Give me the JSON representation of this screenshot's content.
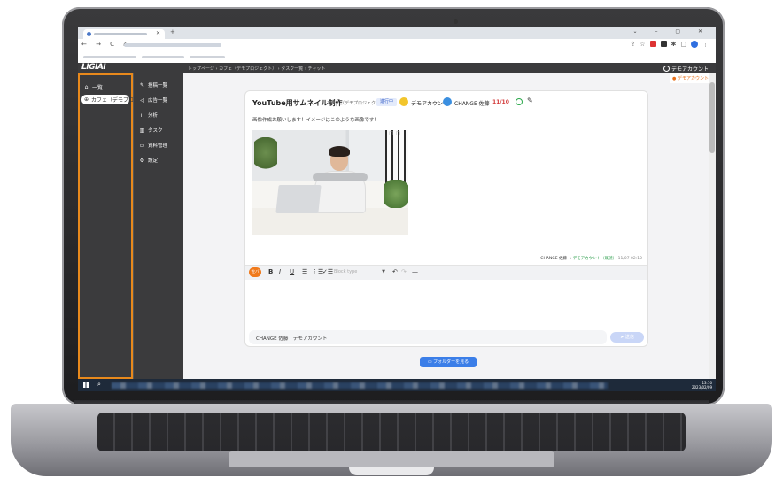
{
  "browser": {
    "window_controls": "⌄ – ▢ ✕",
    "new_tab": "+",
    "tab_close": "✕",
    "nav": "← → C ⌂"
  },
  "app": {
    "logo": "LIGIAI",
    "breadcrumb": "トップページ › カフェ（デモプロジェクト） › タスク一覧 › チャット",
    "account_name": "デモアカウント",
    "account_popup": "● デモアカウント",
    "accent": "#e8891c"
  },
  "sidebar": {
    "items": [
      {
        "icon": "⌂",
        "label": "一覧"
      },
      {
        "icon": "⊕",
        "label": "カフェ（デモプロ..."
      }
    ]
  },
  "subnav": {
    "items": [
      {
        "icon": "✎",
        "label": "投稿一覧"
      },
      {
        "icon": "◁",
        "label": "広告一覧"
      },
      {
        "icon": "ıl",
        "label": "分析"
      },
      {
        "icon": "▥",
        "label": "タスク"
      },
      {
        "icon": "▭",
        "label": "資料管理"
      },
      {
        "icon": "⚙",
        "label": "設定"
      }
    ]
  },
  "task": {
    "title": "YouTube用サムネイル制作",
    "project": "カフェ（デモプロジェクト）",
    "status": "進行中",
    "assignee": "デモアカウント",
    "requester": "CHANGE 佐藤",
    "count": "11/10"
  },
  "message": {
    "text": "画像作成お願いします！イメージはこのような画像です！",
    "sender": "CHANGE 佐藤",
    "arrow": "→",
    "recipient": "デモアカウント（既読）",
    "time": "11/07 02:10"
  },
  "editor": {
    "badge": "佐バ",
    "bold": "B",
    "italic": "I",
    "underline": "U",
    "ul": "☰",
    "ol": "⋮☰",
    "check": "✓☰",
    "block_placeholder": "Block type",
    "undo": "↶",
    "redo": "↷",
    "hr": "—",
    "signature": "CHANGE 佐藤　デモアカウント",
    "send_label": "➤ 送信"
  },
  "folder_button": "▭ フォルダーを見る",
  "taskbar": {
    "time": "13:10",
    "date": "2023/02/09"
  }
}
